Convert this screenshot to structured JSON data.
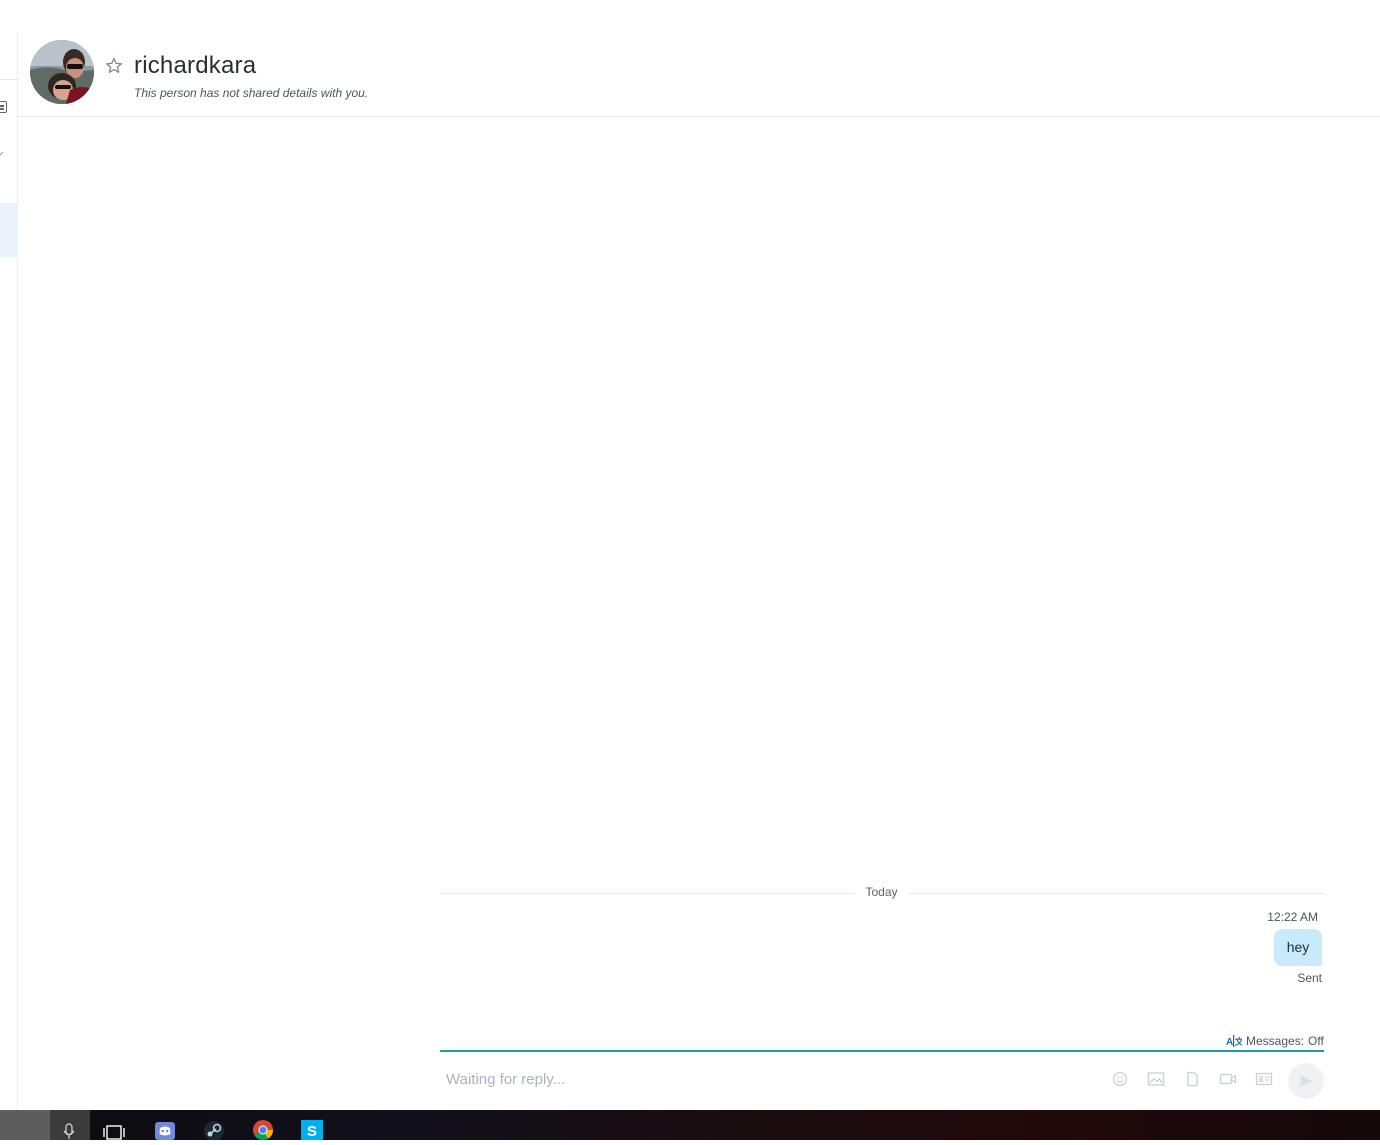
{
  "contact": {
    "name": "richardkara",
    "subtitle": "This person has not shared details with you."
  },
  "conversation": {
    "day_divider": "Today",
    "messages": [
      {
        "time": "12:22 AM",
        "text": "hey",
        "status": "Sent",
        "direction": "outgoing"
      }
    ]
  },
  "translator": {
    "label": "Messages:",
    "value": "Off"
  },
  "composer": {
    "placeholder": "Waiting for reply...",
    "tools": [
      "emoji-icon",
      "image-icon",
      "file-icon",
      "video-message-icon",
      "contact-card-icon"
    ],
    "send_icon": "send-icon"
  },
  "taskbar": {
    "items": [
      "search-box",
      "microphone-icon",
      "task-view-icon",
      "discord-icon",
      "steam-icon",
      "chrome-icon",
      "skype-icon"
    ]
  },
  "colors": {
    "accent": "#1a9ea4",
    "bubble": "#c7ebfb",
    "selected_rail": "#e9f3f9"
  }
}
